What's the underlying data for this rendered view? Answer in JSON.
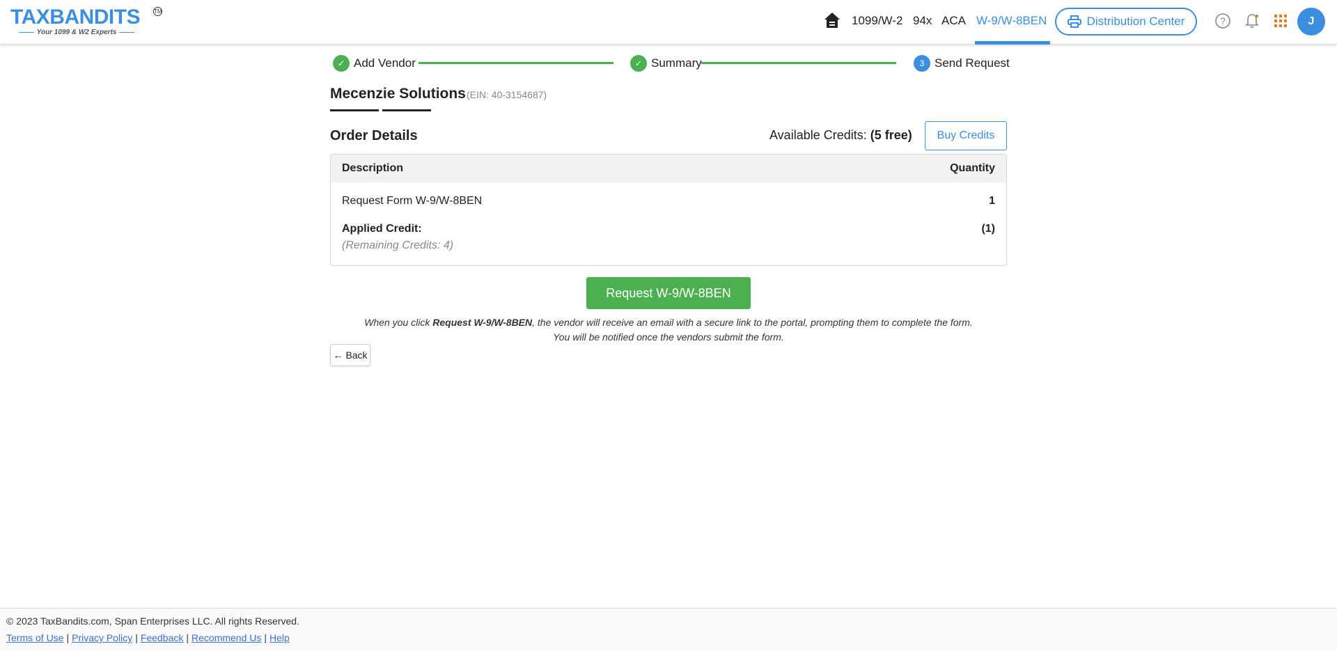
{
  "header": {
    "logo_text": "TAXBANDITS",
    "logo_tagline": "Your 1099 & W2 Experts",
    "logo_tm": "TM",
    "nav": [
      "1099/W-2",
      "94x",
      "ACA",
      "W-9/W-8BEN"
    ],
    "active_nav": "W-9/W-8BEN",
    "distribution_label": "Distribution Center",
    "avatar_initial": "J",
    "accent_color": "#3b8ee0"
  },
  "stepper": {
    "steps": [
      {
        "label": "Add Vendor",
        "status": "done"
      },
      {
        "label": "Summary",
        "status": "done"
      },
      {
        "label": "Send Request",
        "status": "current",
        "number": "3"
      }
    ]
  },
  "vendor": {
    "name": "Mecenzie Solutions",
    "ein": "(EIN: 40-3154687)"
  },
  "order": {
    "title": "Order Details",
    "credits_label": "Available Credits:",
    "credits_value": "(5 free)",
    "buy_label": "Buy Credits",
    "columns": [
      "Description",
      "Quantity"
    ],
    "rows": [
      {
        "description": "Request Form W-9/W-8BEN",
        "quantity": "1"
      },
      {
        "description": "Applied Credit:",
        "note": "(Remaining Credits: 4)",
        "quantity": "(1)"
      }
    ]
  },
  "actions": {
    "request_label": "Request W-9/W-8BEN",
    "note_prefix": "When you click ",
    "note_bold": "Request W-9/W-8BEN",
    "note_suffix": ", the vendor will receive an email with a secure link to the portal, prompting them to complete the form.",
    "note_line2": "You will be notified once the vendors submit the form.",
    "back_label": "Back",
    "primary_color": "#4caf50"
  },
  "footer": {
    "copyright": "© 2023 TaxBandits.com, Span Enterprises LLC. All rights Reserved.",
    "links": [
      "Terms of Use",
      "Privacy Policy",
      "Feedback",
      "Recommend Us",
      "Help"
    ]
  }
}
